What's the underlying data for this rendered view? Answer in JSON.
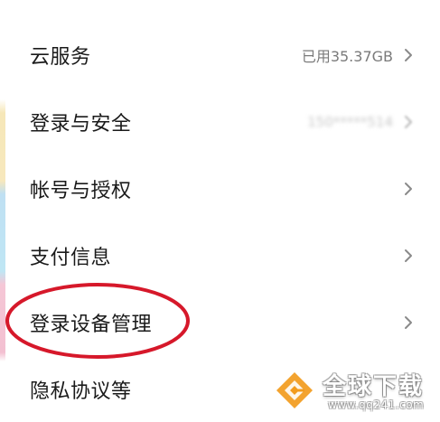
{
  "settings": {
    "items": [
      {
        "label": "云服务",
        "value": "已用35.37GB",
        "has_chevron": true
      },
      {
        "label": "登录与安全",
        "value": "150*****514",
        "value_blurred": true,
        "has_chevron": true
      },
      {
        "label": "帐号与授权",
        "value": "",
        "has_chevron": true
      },
      {
        "label": "支付信息",
        "value": "",
        "has_chevron": true
      },
      {
        "label": "登录设备管理",
        "value": "",
        "has_chevron": true,
        "highlighted": true
      },
      {
        "label": "隐私协议等",
        "value": "",
        "has_chevron": true
      }
    ]
  },
  "annotation": {
    "highlight_color": "#d6182a",
    "highlighted_item": "登录设备管理"
  },
  "watermark": {
    "title": "全球下载",
    "url": "www.qq241.com",
    "logo_color": "#f29b1d"
  },
  "colors": {
    "background": "#ffffff",
    "label": "#1a1a1a",
    "value": "#7a7a7a",
    "chevron": "#8a8a8a"
  },
  "icons": {
    "chevron": "chevron-right-icon",
    "logo": "qq241-logo-icon"
  }
}
